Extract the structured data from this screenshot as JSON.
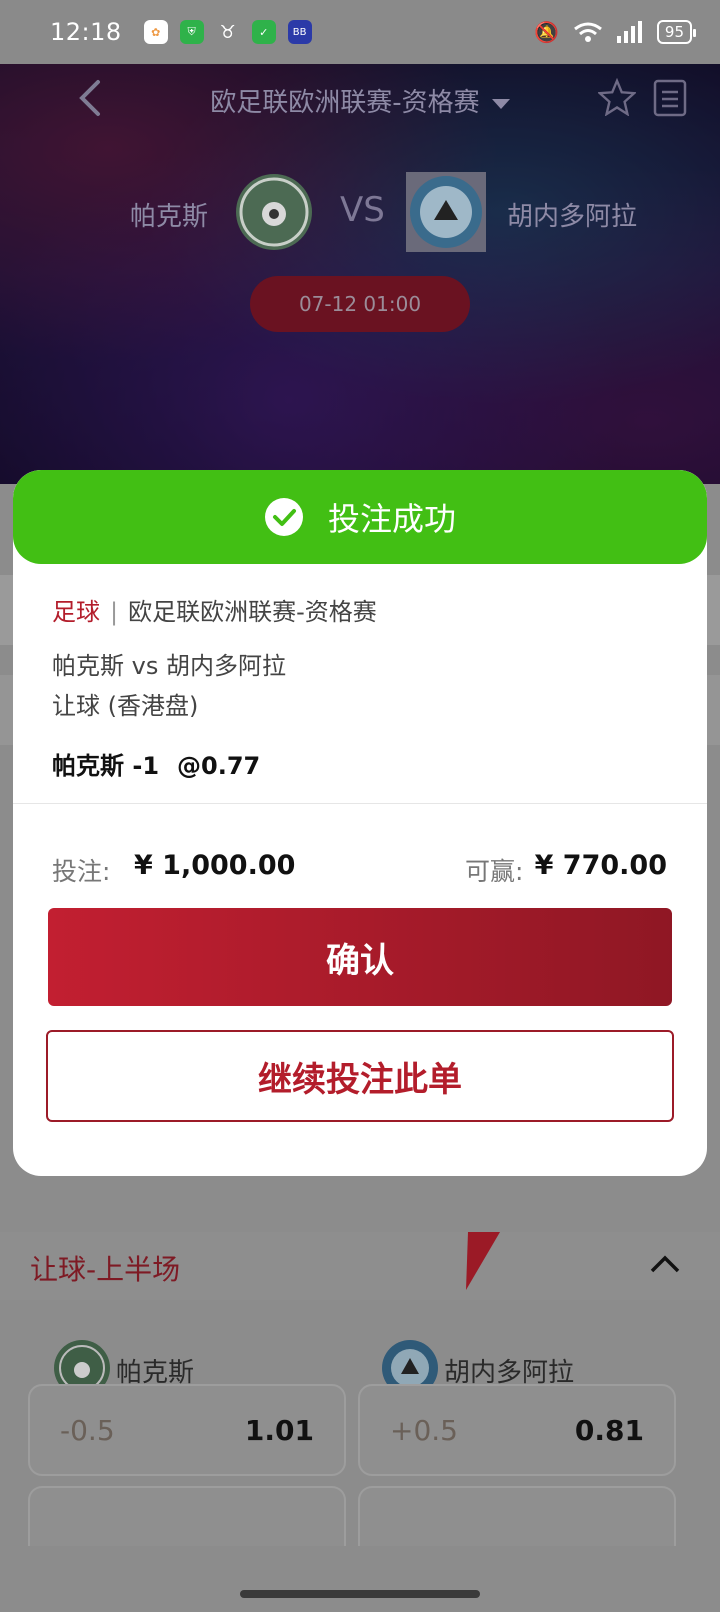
{
  "status_bar": {
    "time": "12:18",
    "battery": "95",
    "apps": [
      "app-store-icon",
      "shield-app-icon",
      "bull-app-icon",
      "security-app-icon",
      "bb-app-icon"
    ]
  },
  "header": {
    "league_title": "欧足联欧洲联赛-资格赛",
    "home_team": "帕克斯",
    "away_team": "胡内多阿拉",
    "vs": "VS",
    "match_time": "07-12 01:00"
  },
  "modal": {
    "title": "投注成功",
    "sport": "足球",
    "separator": "|",
    "league": "欧足联欧洲联赛-资格赛",
    "match": "帕克斯 vs 胡内多阿拉",
    "market": "让球 (香港盘)",
    "selection": "帕克斯 -1",
    "selection_odds": "@0.77",
    "stake_label": "投注:",
    "stake_value": "¥ 1,000.00",
    "win_label": "可赢:",
    "win_value": "¥ 770.00",
    "confirm_label": "确认",
    "continue_label": "继续投注此单"
  },
  "background": {
    "section_title": "让球-上半场",
    "home_team": "帕克斯",
    "away_team": "胡内多阿拉",
    "odds": [
      {
        "handicap": "-0.5",
        "value": "1.01"
      },
      {
        "handicap": "+0.5",
        "value": "0.81"
      }
    ]
  },
  "colors": {
    "success_green": "#42bf14",
    "brand_red": "#b31d2b",
    "confirm_gradient_start": "#c21f31",
    "confirm_gradient_end": "#8f1724"
  }
}
